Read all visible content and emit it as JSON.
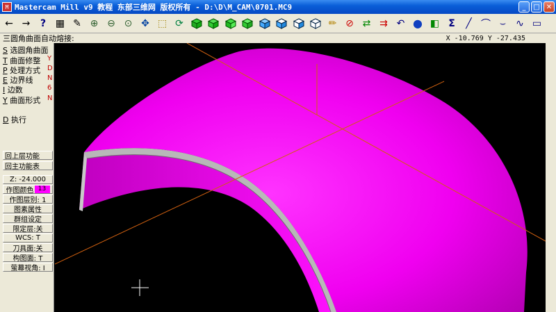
{
  "window": {
    "icon_label": "M",
    "title": "Mastercam Mill v9 教程  东部三维网 版权所有 - D:\\D\\M_CAM\\0701.MC9",
    "minimize": "_",
    "maximize": "□",
    "close": "✕"
  },
  "toolbar": {
    "items": [
      {
        "name": "back-arrow-icon",
        "glyph": "←"
      },
      {
        "name": "forward-arrow-icon",
        "glyph": "→"
      },
      {
        "name": "help-icon",
        "glyph": "?"
      },
      {
        "name": "calculator-icon",
        "glyph": "▦"
      },
      {
        "name": "screen-tools-icon",
        "glyph": "✎"
      },
      {
        "name": "zoom-in-icon",
        "glyph": "⊕"
      },
      {
        "name": "zoom-out-icon",
        "glyph": "⊖"
      },
      {
        "name": "zoom-window-icon",
        "glyph": "⊙"
      },
      {
        "name": "pan-icon",
        "glyph": "✥"
      },
      {
        "name": "select-icon",
        "glyph": "⬚"
      },
      {
        "name": "rotate-icon",
        "glyph": "⟳"
      }
    ],
    "cube_views": [
      "top-view-icon",
      "front-view-icon",
      "side-view-icon",
      "iso-view-icon",
      "view-5-icon",
      "view-6-icon",
      "view-7-icon",
      "view-8-icon"
    ],
    "tail_items": [
      {
        "name": "pencil-icon",
        "glyph": "✏"
      },
      {
        "name": "no-entry-icon",
        "glyph": "⊘"
      },
      {
        "name": "transform-icon",
        "glyph": "⇄"
      },
      {
        "name": "multi-icon",
        "glyph": "⇉"
      },
      {
        "name": "undo-icon",
        "glyph": "↶"
      },
      {
        "name": "shade-sphere-icon",
        "glyph": "●"
      },
      {
        "name": "layers-icon",
        "glyph": "◧"
      },
      {
        "name": "sum-icon",
        "glyph": "Σ"
      },
      {
        "name": "line-icon",
        "glyph": "╱"
      },
      {
        "name": "arc-icon",
        "glyph": "⌒"
      },
      {
        "name": "fillet-icon",
        "glyph": "⌣"
      },
      {
        "name": "spline-icon",
        "glyph": "∿"
      },
      {
        "name": "rectangle-icon",
        "glyph": "▭"
      }
    ]
  },
  "prompt": {
    "text": "三圆角曲面自动熔接:",
    "coords": "X -10.769  Y -27.435"
  },
  "menu": {
    "items": [
      {
        "key": "S",
        "label": "选圆角曲面",
        "value": ""
      },
      {
        "key": "T",
        "label": "曲面修整",
        "value": "Y"
      },
      {
        "key": "P",
        "label": "处理方式",
        "value": "D"
      },
      {
        "key": "E",
        "label": "边界线",
        "value": "N"
      },
      {
        "key": "I",
        "label": "边数",
        "value": "6"
      },
      {
        "key": "Y",
        "label": "曲面形式",
        "value": "N"
      }
    ],
    "execute_key": "D",
    "execute_label": "执行",
    "back_label": "回上层功能",
    "main_label": "回主功能表",
    "z_label": "Z: -24.000",
    "color_label": "作图颜色",
    "color_value": "13",
    "level_label": "作图层别: 1",
    "attr_label": "图素属性",
    "group_label": "群组设定",
    "limit_label": "限定层:关",
    "wcs_label": "WCS:  T",
    "tool_label": "刀具面:关",
    "construct_label": "构图面: T",
    "view_label": "萤幕视角: I"
  },
  "colors": {
    "surface": "#ff00ff",
    "fillet": "#b0b0b0",
    "axis": "#d06010",
    "background": "#000000"
  }
}
